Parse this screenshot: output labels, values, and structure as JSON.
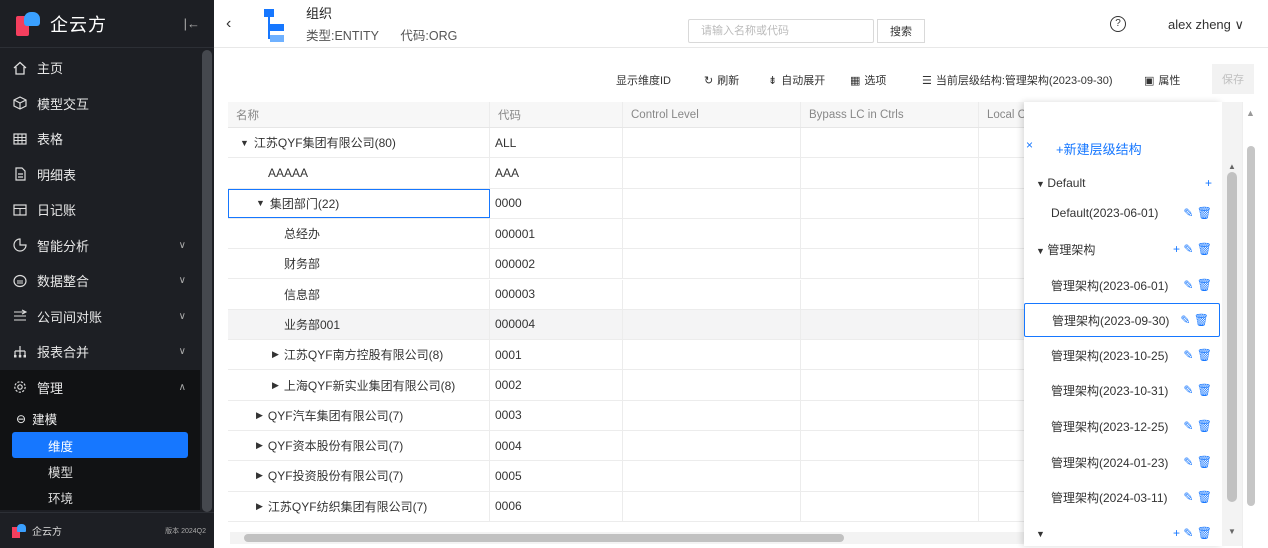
{
  "app": {
    "name": "企云方",
    "footer_name": "企云方",
    "version": "版本 2024Q2"
  },
  "sidebar": {
    "items": [
      {
        "label": "主页",
        "icon": "home-icon"
      },
      {
        "label": "模型交互",
        "icon": "cube-icon"
      },
      {
        "label": "表格",
        "icon": "table-icon"
      },
      {
        "label": "明细表",
        "icon": "doc-icon"
      },
      {
        "label": "日记账",
        "icon": "journal-icon"
      },
      {
        "label": "智能分析",
        "icon": "chart-icon"
      },
      {
        "label": "数据整合",
        "icon": "data-icon"
      },
      {
        "label": "公司间对账",
        "icon": "reconcile-icon"
      },
      {
        "label": "报表合并",
        "icon": "merge-icon"
      },
      {
        "label": "管理",
        "icon": "gear-icon"
      }
    ],
    "sub_group": "建模",
    "leaves": [
      "维度",
      "模型",
      "环境"
    ],
    "active_leaf": "维度"
  },
  "header": {
    "title": "组织",
    "type_label": "类型:ENTITY",
    "code_label": "代码:ORG",
    "search_placeholder": "请输入名称或代码",
    "search_button": "搜索",
    "help": "?",
    "user": "alex zheng ∨"
  },
  "toolbar": {
    "show_id": "显示维度ID",
    "refresh": "刷新",
    "auto_expand": "自动展开",
    "options": "选项",
    "current_structure": "当前层级结构:管理架构(2023-09-30)",
    "properties": "属性",
    "save": "保存"
  },
  "table": {
    "columns": [
      "名称",
      "代码",
      "Control Level",
      "Bypass LC in Ctrls",
      "Local C"
    ],
    "rows": [
      {
        "name": "江苏QYF集团有限公司(80)",
        "code": "ALL",
        "caret": "▼",
        "indent": 0
      },
      {
        "name": "AAAAA",
        "code": "AAA",
        "caret": "",
        "indent": 1
      },
      {
        "name": "集团部门(22)",
        "code": "0000",
        "caret": "▼",
        "indent": 1
      },
      {
        "name": "总经办",
        "code": "000001",
        "caret": "",
        "indent": 2
      },
      {
        "name": "财务部",
        "code": "000002",
        "caret": "",
        "indent": 2
      },
      {
        "name": "信息部",
        "code": "000003",
        "caret": "",
        "indent": 2
      },
      {
        "name": "业务部001",
        "code": "000004",
        "caret": "",
        "indent": 2
      },
      {
        "name": "江苏QYF南方控股有限公司(8)",
        "code": "0001",
        "caret": "▶",
        "indent": 2
      },
      {
        "name": "上海QYF新实业集团有限公司(8)",
        "code": "0002",
        "caret": "▶",
        "indent": 2
      },
      {
        "name": "QYF汽车集团有限公司(7)",
        "code": "0003",
        "caret": "▶",
        "indent": 1
      },
      {
        "name": "QYF资本股份有限公司(7)",
        "code": "0004",
        "caret": "▶",
        "indent": 1
      },
      {
        "name": "QYF投资股份有限公司(7)",
        "code": "0005",
        "caret": "▶",
        "indent": 1
      },
      {
        "name": "江苏QYF纺织集团有限公司(7)",
        "code": "0006",
        "caret": "▶",
        "indent": 1
      }
    ]
  },
  "panel": {
    "close": "×",
    "new_structure": "+新建层级结构",
    "items": [
      {
        "label": "Default",
        "group": true,
        "actions": "+"
      },
      {
        "label": "Default(2023-06-01)",
        "group": false,
        "actions": "✎ 🗑"
      },
      {
        "label": "管理架构",
        "group": true,
        "actions": "+ ✎ 🗑"
      },
      {
        "label": "管理架构(2023-06-01)",
        "group": false,
        "actions": "✎ 🗑"
      },
      {
        "label": "管理架构(2023-09-30)",
        "group": false,
        "actions": "✎ 🗑",
        "selected": true
      },
      {
        "label": "管理架构(2023-10-25)",
        "group": false,
        "actions": "✎ 🗑"
      },
      {
        "label": "管理架构(2023-10-31)",
        "group": false,
        "actions": "✎ 🗑"
      },
      {
        "label": "管理架构(2023-12-25)",
        "group": false,
        "actions": "✎ 🗑"
      },
      {
        "label": "管理架构(2024-01-23)",
        "group": false,
        "actions": "✎ 🗑"
      },
      {
        "label": "管理架构(2024-03-11)",
        "group": false,
        "actions": "✎ 🗑"
      },
      {
        "label": "",
        "group": true,
        "actions": "+ ✎ 🗑"
      }
    ]
  }
}
